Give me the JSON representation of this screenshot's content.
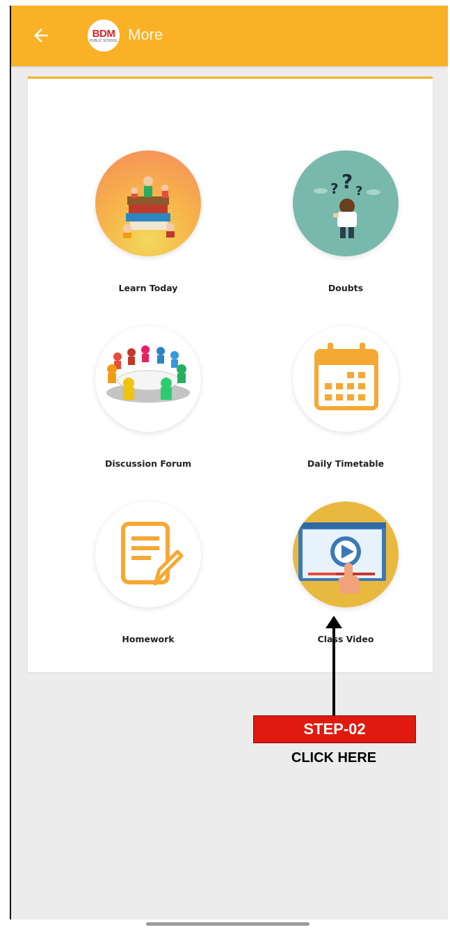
{
  "appbar": {
    "title": "More",
    "logo_text": "BDM",
    "logo_subtext": "PUBLIC SCHOOL"
  },
  "tiles": [
    {
      "label": "Learn Today",
      "icon": "books-students-icon"
    },
    {
      "label": "Doubts",
      "icon": "question-person-icon"
    },
    {
      "label": "Discussion Forum",
      "icon": "round-table-meeting-icon"
    },
    {
      "label": "Daily Timetable",
      "icon": "calendar-icon"
    },
    {
      "label": "Homework",
      "icon": "notepad-pencil-icon"
    },
    {
      "label": "Class Video",
      "icon": "video-player-icon"
    }
  ],
  "annotation": {
    "step_label": "STEP-02",
    "instruction": "CLICK HERE"
  },
  "colors": {
    "appbar": "#fbb125",
    "accent": "#f2b024",
    "step_box": "#e01a0f"
  }
}
